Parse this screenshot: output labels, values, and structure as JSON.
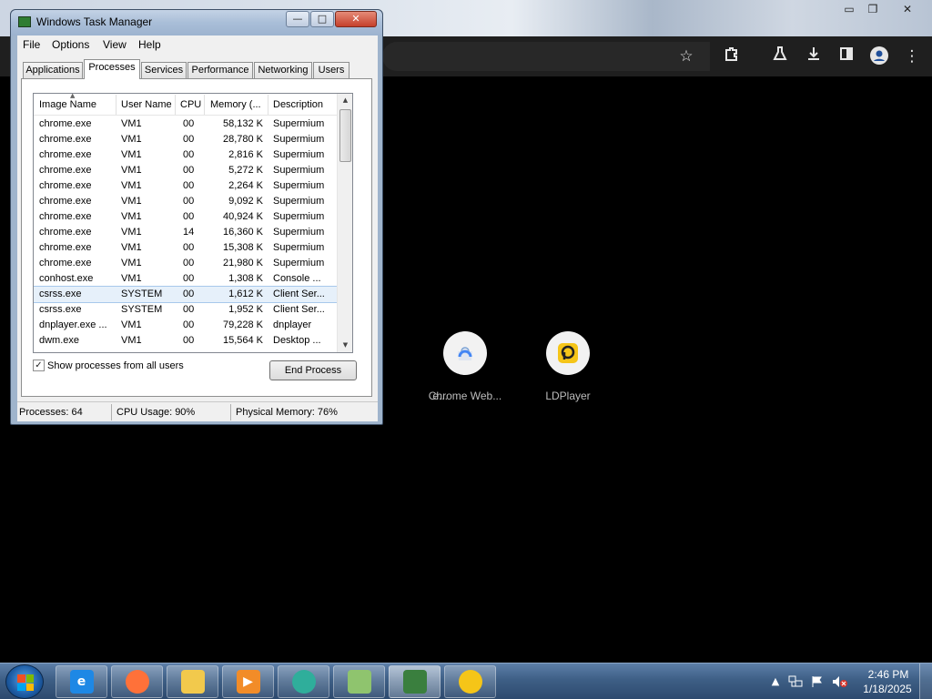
{
  "browser": {
    "controls": {
      "minimize": "▭",
      "restore": "❐",
      "close": "✕"
    },
    "toolbar_icons": [
      "star-icon",
      "extensions-icon",
      "labs-icon",
      "download-icon",
      "side-panel-icon",
      "profile-icon",
      "menu-icon"
    ],
    "shortcuts": [
      {
        "label": "e...",
        "icon": "partial-shortcut-icon"
      },
      {
        "label": "Chrome Web...",
        "icon": "chrome-web-store-icon"
      },
      {
        "label": "LDPlayer",
        "icon": "ldplayer-icon"
      }
    ]
  },
  "taskmgr": {
    "title": "Windows Task Manager",
    "controls": {
      "minimize": "—",
      "maximize": "□",
      "close": "✕"
    },
    "menu": [
      "File",
      "Options",
      "View",
      "Help"
    ],
    "tabs": [
      "Applications",
      "Processes",
      "Services",
      "Performance",
      "Networking",
      "Users"
    ],
    "active_tab": "Processes",
    "columns": [
      "Image Name",
      "User Name",
      "CPU",
      "Memory (...",
      "Description"
    ],
    "rows": [
      {
        "name": "chrome.exe",
        "user": "VM1",
        "cpu": "00",
        "mem": "58,132 K",
        "desc": "Supermium"
      },
      {
        "name": "chrome.exe",
        "user": "VM1",
        "cpu": "00",
        "mem": "28,780 K",
        "desc": "Supermium"
      },
      {
        "name": "chrome.exe",
        "user": "VM1",
        "cpu": "00",
        "mem": "2,816 K",
        "desc": "Supermium"
      },
      {
        "name": "chrome.exe",
        "user": "VM1",
        "cpu": "00",
        "mem": "5,272 K",
        "desc": "Supermium"
      },
      {
        "name": "chrome.exe",
        "user": "VM1",
        "cpu": "00",
        "mem": "2,264 K",
        "desc": "Supermium"
      },
      {
        "name": "chrome.exe",
        "user": "VM1",
        "cpu": "00",
        "mem": "9,092 K",
        "desc": "Supermium"
      },
      {
        "name": "chrome.exe",
        "user": "VM1",
        "cpu": "00",
        "mem": "40,924 K",
        "desc": "Supermium"
      },
      {
        "name": "chrome.exe",
        "user": "VM1",
        "cpu": "14",
        "mem": "16,360 K",
        "desc": "Supermium"
      },
      {
        "name": "chrome.exe",
        "user": "VM1",
        "cpu": "00",
        "mem": "15,308 K",
        "desc": "Supermium"
      },
      {
        "name": "chrome.exe",
        "user": "VM1",
        "cpu": "00",
        "mem": "21,980 K",
        "desc": "Supermium"
      },
      {
        "name": "conhost.exe",
        "user": "VM1",
        "cpu": "00",
        "mem": "1,308 K",
        "desc": "Console ..."
      },
      {
        "name": "csrss.exe",
        "user": "SYSTEM",
        "cpu": "00",
        "mem": "1,612 K",
        "desc": "Client Ser...",
        "selected": true
      },
      {
        "name": "csrss.exe",
        "user": "SYSTEM",
        "cpu": "00",
        "mem": "1,952 K",
        "desc": "Client Ser..."
      },
      {
        "name": "dnplayer.exe ...",
        "user": "VM1",
        "cpu": "00",
        "mem": "79,228 K",
        "desc": "dnplayer"
      },
      {
        "name": "dwm.exe",
        "user": "VM1",
        "cpu": "00",
        "mem": "15,564 K",
        "desc": "Desktop ..."
      }
    ],
    "show_all_label": "Show processes from all users",
    "show_all_checked": "✓",
    "end_process_label": "End Process",
    "status": {
      "processes": "Processes: 64",
      "cpu": "CPU Usage: 90%",
      "memory": "Physical Memory: 76%"
    }
  },
  "taskbar": {
    "buttons": [
      {
        "name": "internet-explorer",
        "icon": "ie-icon",
        "glyph": "e",
        "color": "#1e88e5"
      },
      {
        "name": "firefox",
        "icon": "firefox-icon",
        "glyph": "",
        "color": "#ff7139"
      },
      {
        "name": "file-explorer",
        "icon": "folder-icon",
        "glyph": "",
        "color": "#f2c94c"
      },
      {
        "name": "media-player",
        "icon": "media-player-icon",
        "glyph": "▶",
        "color": "#f28c28"
      },
      {
        "name": "chat-app",
        "icon": "chat-bubble-icon",
        "glyph": "",
        "color": "#2fae9b"
      },
      {
        "name": "maps-app",
        "icon": "map-icon",
        "glyph": "",
        "color": "#8fc46e"
      },
      {
        "name": "task-manager",
        "icon": "task-manager-icon",
        "glyph": "",
        "color": "#3a7f3e",
        "active": true
      },
      {
        "name": "ldplayer",
        "icon": "ldplayer-icon",
        "glyph": "",
        "color": "#f5c518"
      }
    ],
    "tray": {
      "time": "2:46 PM",
      "date": "1/18/2025"
    }
  },
  "colors": {
    "selection": "#e6f0fa",
    "taskbar": "#3e5f86",
    "ldplayer_yellow": "#f5c518"
  }
}
